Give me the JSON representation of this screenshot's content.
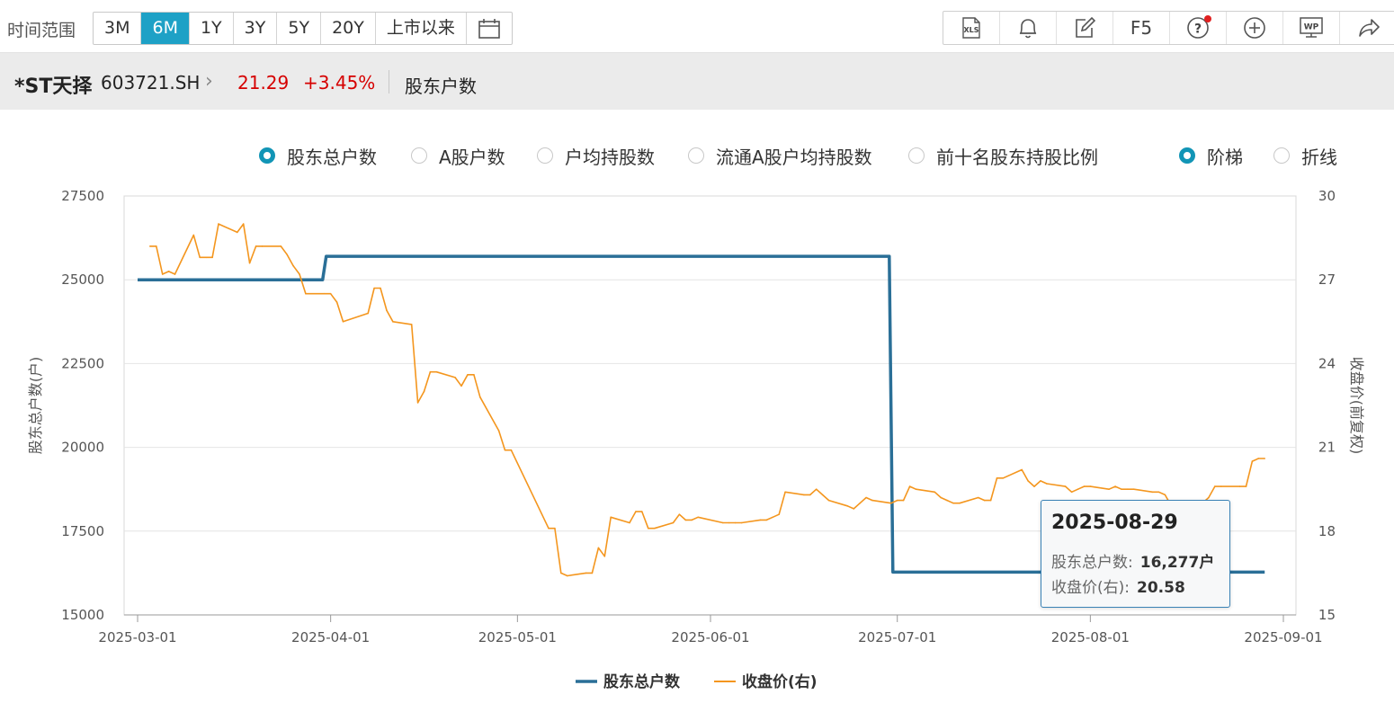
{
  "toolbar": {
    "range_label": "时间范围",
    "ranges": [
      "3M",
      "6M",
      "1Y",
      "3Y",
      "5Y",
      "20Y",
      "上市以来"
    ],
    "active_range": "6M",
    "tools": [
      "XLS",
      "bell",
      "edit",
      "F5",
      "help",
      "add",
      "WP",
      "share"
    ],
    "f5_label": "F5"
  },
  "stock": {
    "name": "*ST天择",
    "code": "603721.SH",
    "price": "21.29",
    "change": "+3.45%",
    "page_title": "股东户数"
  },
  "options": {
    "metrics": [
      "股东总户数",
      "A股户数",
      "户均持股数",
      "流通A股户均持股数",
      "前十名股东持股比例"
    ],
    "selected_metric": "股东总户数",
    "styles": [
      "阶梯",
      "折线"
    ],
    "selected_style": "阶梯"
  },
  "colors": {
    "accent": "#1ea1c6",
    "holders_line": "#2a6f97",
    "price_line": "#f4961e",
    "up": "#d60000"
  },
  "chart_data": {
    "type": "line",
    "ylabel_left": "股东总户数(户)",
    "ylabel_right": "收盘价(前复权)",
    "ylim_left": [
      15000,
      27500
    ],
    "ylim_right": [
      15,
      30
    ],
    "yticks_left": [
      "27500",
      "25000",
      "22500",
      "20000",
      "17500",
      "15000"
    ],
    "yticks_right": [
      "30",
      "27",
      "24",
      "21",
      "18",
      "15"
    ],
    "xticks": [
      "2025-03-01",
      "2025-04-01",
      "2025-05-01",
      "2025-06-01",
      "2025-07-01",
      "2025-08-01",
      "2025-09-01"
    ],
    "xlim": [
      "2025-03-01",
      "2025-09-01"
    ],
    "grid": true,
    "legend_position": "bottom",
    "series": [
      {
        "name": "股东总户数",
        "axis": "left",
        "style": "step",
        "x": [
          "2025-03-01",
          "2025-03-31",
          "2025-06-30",
          "2025-08-29"
        ],
        "values": [
          25000,
          25700,
          16277,
          16277
        ]
      },
      {
        "name": "收盘价(右)",
        "axis": "right",
        "style": "line",
        "x": [
          "2025-03-03",
          "2025-03-04",
          "2025-03-05",
          "2025-03-06",
          "2025-03-07",
          "2025-03-10",
          "2025-03-11",
          "2025-03-12",
          "2025-03-13",
          "2025-03-14",
          "2025-03-17",
          "2025-03-18",
          "2025-03-19",
          "2025-03-20",
          "2025-03-21",
          "2025-03-24",
          "2025-03-25",
          "2025-03-26",
          "2025-03-27",
          "2025-03-28",
          "2025-03-31",
          "2025-04-01",
          "2025-04-02",
          "2025-04-03",
          "2025-04-07",
          "2025-04-08",
          "2025-04-09",
          "2025-04-10",
          "2025-04-11",
          "2025-04-14",
          "2025-04-15",
          "2025-04-16",
          "2025-04-17",
          "2025-04-18",
          "2025-04-21",
          "2025-04-22",
          "2025-04-23",
          "2025-04-24",
          "2025-04-25",
          "2025-04-28",
          "2025-04-29",
          "2025-04-30",
          "2025-05-06",
          "2025-05-07",
          "2025-05-08",
          "2025-05-09",
          "2025-05-12",
          "2025-05-13",
          "2025-05-14",
          "2025-05-15",
          "2025-05-16",
          "2025-05-19",
          "2025-05-20",
          "2025-05-21",
          "2025-05-22",
          "2025-05-23",
          "2025-05-26",
          "2025-05-27",
          "2025-05-28",
          "2025-05-29",
          "2025-05-30",
          "2025-06-03",
          "2025-06-04",
          "2025-06-05",
          "2025-06-06",
          "2025-06-09",
          "2025-06-10",
          "2025-06-11",
          "2025-06-12",
          "2025-06-13",
          "2025-06-16",
          "2025-06-17",
          "2025-06-18",
          "2025-06-19",
          "2025-06-20",
          "2025-06-23",
          "2025-06-24",
          "2025-06-25",
          "2025-06-26",
          "2025-06-27",
          "2025-06-30",
          "2025-07-01",
          "2025-07-02",
          "2025-07-03",
          "2025-07-04",
          "2025-07-07",
          "2025-07-08",
          "2025-07-09",
          "2025-07-10",
          "2025-07-11",
          "2025-07-14",
          "2025-07-15",
          "2025-07-16",
          "2025-07-17",
          "2025-07-18",
          "2025-07-21",
          "2025-07-22",
          "2025-07-23",
          "2025-07-24",
          "2025-07-25",
          "2025-07-28",
          "2025-07-29",
          "2025-07-30",
          "2025-07-31",
          "2025-08-01",
          "2025-08-04",
          "2025-08-05",
          "2025-08-06",
          "2025-08-07",
          "2025-08-08",
          "2025-08-11",
          "2025-08-12",
          "2025-08-13",
          "2025-08-14",
          "2025-08-15",
          "2025-08-18",
          "2025-08-19",
          "2025-08-20",
          "2025-08-21",
          "2025-08-22",
          "2025-08-25",
          "2025-08-26",
          "2025-08-27",
          "2025-08-28",
          "2025-08-29"
        ],
        "values": [
          28.2,
          28.2,
          27.2,
          27.3,
          27.2,
          28.6,
          27.8,
          27.8,
          27.8,
          29.0,
          28.7,
          29.0,
          27.6,
          28.2,
          28.2,
          28.2,
          27.9,
          27.5,
          27.2,
          26.5,
          26.5,
          26.5,
          26.2,
          25.5,
          25.8,
          26.7,
          26.7,
          25.9,
          25.5,
          25.4,
          22.6,
          23.0,
          23.7,
          23.7,
          23.5,
          23.2,
          23.6,
          23.6,
          22.8,
          21.6,
          20.9,
          20.9,
          18.1,
          18.1,
          16.5,
          16.4,
          16.5,
          16.5,
          17.4,
          17.1,
          18.5,
          18.3,
          18.7,
          18.7,
          18.1,
          18.1,
          18.3,
          18.6,
          18.4,
          18.4,
          18.5,
          18.3,
          18.3,
          18.3,
          18.3,
          18.4,
          18.4,
          18.5,
          18.6,
          19.4,
          19.3,
          19.3,
          19.5,
          19.3,
          19.1,
          18.9,
          18.8,
          19.0,
          19.2,
          19.1,
          19.0,
          19.1,
          19.1,
          19.6,
          19.5,
          19.4,
          19.2,
          19.1,
          19.0,
          19.0,
          19.2,
          19.1,
          19.1,
          19.9,
          19.9,
          20.2,
          19.8,
          19.6,
          19.8,
          19.7,
          19.6,
          19.4,
          19.5,
          19.6,
          19.6,
          19.5,
          19.6,
          19.5,
          19.5,
          19.5,
          19.4,
          19.4,
          19.3,
          18.9,
          18.9,
          18.9,
          19.0,
          19.2,
          19.6,
          19.6,
          19.6,
          19.6,
          20.5,
          20.6,
          20.6
        ]
      }
    ],
    "legend": [
      "股东总户数",
      "收盘价(右)"
    ],
    "tooltip": {
      "date": "2025-08-29",
      "holders_label": "股东总户数:",
      "holders_value": "16,277户",
      "price_label": "收盘价(右):",
      "price_value": "20.58"
    }
  }
}
